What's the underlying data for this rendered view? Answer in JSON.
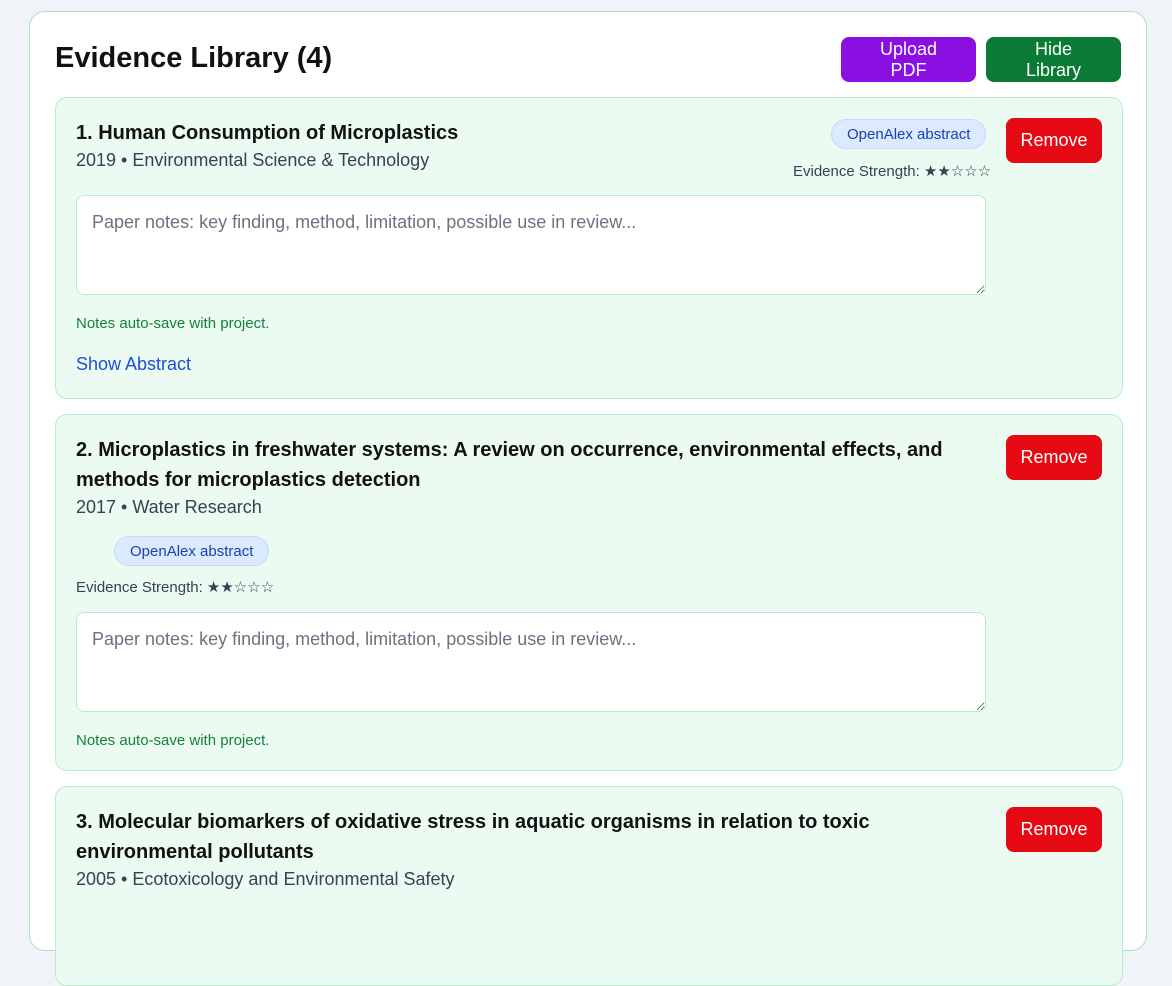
{
  "library": {
    "title": "Evidence Library (4)",
    "upload_label": "Upload PDF",
    "hide_label": "Hide Library",
    "remove_label": "Remove",
    "notes_placeholder": "Paper notes: key finding, method, limitation, possible use in review...",
    "autosave_text": "Notes auto-save with project.",
    "show_abstract_label": "Show Abstract",
    "papers": [
      {
        "title": "1. Human Consumption of Microplastics",
        "meta": "2019 • Environmental Science & Technology",
        "badge": "OpenAlex abstract",
        "strength": "Evidence Strength: ★★☆☆☆"
      },
      {
        "title_line1": "2. Microplastics in freshwater systems: A review on occurrence, environmental effects, and",
        "title_line2": "methods for microplastics detection",
        "meta": "2017 • Water Research",
        "badge": "OpenAlex abstract",
        "strength": "Evidence Strength: ★★☆☆☆"
      },
      {
        "title_line1": "3. Molecular biomarkers of oxidative stress in aquatic organisms in relation to toxic",
        "title_line2": "environmental pollutants",
        "meta": "2005 • Ecotoxicology and Environmental Safety"
      }
    ]
  },
  "colors": {
    "upload": "#8b0fe0",
    "hide": "#0a7a35",
    "remove": "#e50914",
    "card_bg": "#ecfbf1",
    "badge_bg": "#dbeafe"
  }
}
